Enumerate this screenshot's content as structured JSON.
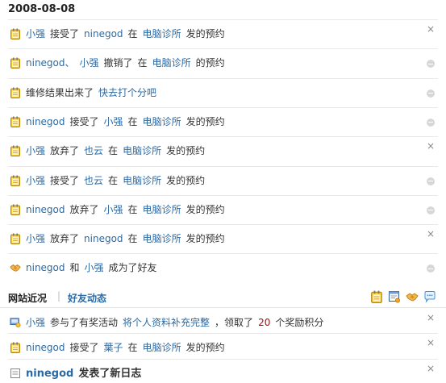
{
  "date_header": "2008-08-08",
  "rows": [
    {
      "icon": "notepad-icon",
      "action": "close",
      "parts": [
        {
          "t": "小强",
          "c": "lnk"
        },
        {
          "t": "接受了",
          "c": "plain"
        },
        {
          "t": "ninegod",
          "c": "lnk"
        },
        {
          "t": "在",
          "c": "plain"
        },
        {
          "t": "电脑诊所",
          "c": "lnk"
        },
        {
          "t": "发的预约",
          "c": "plain"
        }
      ]
    },
    {
      "icon": "notepad-icon",
      "action": "remove",
      "parts": [
        {
          "t": "ninegod、",
          "c": "lnk"
        },
        {
          "t": "小强",
          "c": "lnk"
        },
        {
          "t": "撤销了",
          "c": "plain"
        },
        {
          "t": "在",
          "c": "plain"
        },
        {
          "t": "电脑诊所",
          "c": "lnk"
        },
        {
          "t": "的预约",
          "c": "plain"
        }
      ]
    },
    {
      "icon": "notepad-icon",
      "action": "remove",
      "parts": [
        {
          "t": "维修结果出来了",
          "c": "plain"
        },
        {
          "t": "快去打个分吧",
          "c": "lnk"
        }
      ]
    },
    {
      "icon": "notepad-icon",
      "action": "remove",
      "parts": [
        {
          "t": "ninegod",
          "c": "lnk"
        },
        {
          "t": "接受了",
          "c": "plain"
        },
        {
          "t": "小强",
          "c": "lnk"
        },
        {
          "t": "在",
          "c": "plain"
        },
        {
          "t": "电脑诊所",
          "c": "lnk"
        },
        {
          "t": "发的预约",
          "c": "plain"
        }
      ]
    },
    {
      "icon": "notepad-icon",
      "action": "close",
      "parts": [
        {
          "t": "小强",
          "c": "lnk"
        },
        {
          "t": "放弃了",
          "c": "plain"
        },
        {
          "t": "也云",
          "c": "lnk"
        },
        {
          "t": "在",
          "c": "plain"
        },
        {
          "t": "电脑诊所",
          "c": "lnk"
        },
        {
          "t": "发的预约",
          "c": "plain"
        }
      ]
    },
    {
      "icon": "notepad-icon",
      "action": "remove",
      "parts": [
        {
          "t": "小强",
          "c": "lnk"
        },
        {
          "t": "接受了",
          "c": "plain"
        },
        {
          "t": "也云",
          "c": "lnk"
        },
        {
          "t": "在",
          "c": "plain"
        },
        {
          "t": "电脑诊所",
          "c": "lnk"
        },
        {
          "t": "发的预约",
          "c": "plain"
        }
      ]
    },
    {
      "icon": "notepad-icon",
      "action": "remove",
      "parts": [
        {
          "t": "ninegod",
          "c": "lnk"
        },
        {
          "t": "放弃了",
          "c": "plain"
        },
        {
          "t": "小强",
          "c": "lnk"
        },
        {
          "t": "在",
          "c": "plain"
        },
        {
          "t": "电脑诊所",
          "c": "lnk"
        },
        {
          "t": "发的预约",
          "c": "plain"
        }
      ]
    },
    {
      "icon": "notepad-icon",
      "action": "close",
      "parts": [
        {
          "t": "小强",
          "c": "lnk"
        },
        {
          "t": "放弃了",
          "c": "plain"
        },
        {
          "t": "ninegod",
          "c": "lnk"
        },
        {
          "t": "在",
          "c": "plain"
        },
        {
          "t": "电脑诊所",
          "c": "lnk"
        },
        {
          "t": "发的预约",
          "c": "plain"
        }
      ]
    },
    {
      "icon": "handshake-icon",
      "action": "remove",
      "parts": [
        {
          "t": "ninegod",
          "c": "lnk"
        },
        {
          "t": "和",
          "c": "plain"
        },
        {
          "t": "小强",
          "c": "lnk"
        },
        {
          "t": "成为了好友",
          "c": "plain"
        }
      ]
    }
  ],
  "tabs": {
    "active": "网站近况",
    "other": "好友动态"
  },
  "filter_icons": [
    "notepad-icon",
    "news-icon",
    "handshake-icon",
    "speech-bubble-icon"
  ],
  "rows2": [
    {
      "icon": "reward-icon",
      "action": "close",
      "parts": [
        {
          "t": "小强",
          "c": "lnk"
        },
        {
          "t": "参与了有奖活动",
          "c": "plain"
        },
        {
          "t": "将个人资料补充完整",
          "c": "lnk"
        },
        {
          "t": "，领取了",
          "c": "plain"
        },
        {
          "t": "20",
          "c": "hl"
        },
        {
          "t": "个奖励积分",
          "c": "plain"
        }
      ]
    },
    {
      "icon": "notepad-icon",
      "action": "close",
      "parts": [
        {
          "t": "ninegod",
          "c": "lnk"
        },
        {
          "t": "接受了",
          "c": "plain"
        },
        {
          "t": "葉子",
          "c": "lnk"
        },
        {
          "t": "在",
          "c": "plain"
        },
        {
          "t": "电脑诊所",
          "c": "lnk"
        },
        {
          "t": "发的预约",
          "c": "plain"
        }
      ]
    },
    {
      "icon": "blog-icon",
      "action": "close",
      "parts": [
        {
          "t": "ninegod",
          "c": "bold-lnk"
        },
        {
          "t": "发表了新日志",
          "c": "bold-plain"
        }
      ]
    }
  ]
}
